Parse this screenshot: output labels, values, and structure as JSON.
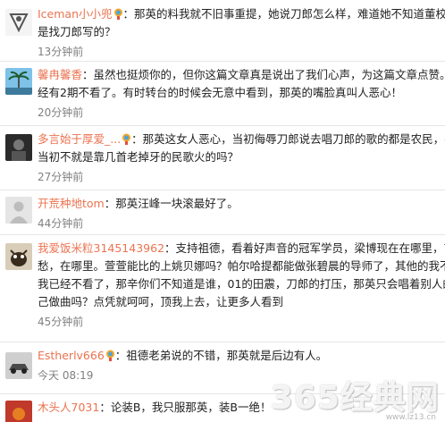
{
  "comments": [
    {
      "user": "Iceman小小兜",
      "lines": [
        "：那英的料我就不旧事重提，她说刀郎怎么样，难道她不知道董校长的一首歌就",
        "是找刀郎写的？"
      ],
      "time": "13分钟前",
      "avatar": "avatar-crest"
    },
    {
      "user": "馨冉馨香",
      "lines": [
        "：虽然也挺烦你的，但你这篇文章真是说出了我们心声，为这篇文章点赞。因为",
        "经有2期不看了。有时转台的时候会无意中看到，那英的嘴脸真叫人恶心！"
      ],
      "time": "20分钟前",
      "avatar": "avatar-palm"
    },
    {
      "user": "多言始于厚爱_...",
      "lines": [
        "：那英这女人恶心，当初侮辱刀郎说去唱刀郎的歌的都是农民，农民",
        "当初不就是靠几首老掉牙的民歌火的吗？"
      ],
      "time": "27分钟前",
      "avatar": "avatar-dark"
    },
    {
      "user": "开荒种地tom",
      "lines": [
        "：那英汪峰一块滚最好了。"
      ],
      "time": "44分钟前",
      "avatar": "avatar-default"
    },
    {
      "user": "我爱饭米粒3145143962",
      "lines": [
        "：支持祖德，看着好声音的冠军学员，梁博现在在哪里，吉克隽逸",
        "愁，在哪里。萱萱能比的上姚贝娜吗？帕尔哈提都能做张碧晨的导师了，其他的我不想再",
        "我已经不看了，那辛你们不知道是谁，01的田震，刀郎的打压，那英只会唱着别人的歌",
        "己做曲吗？点凭就呵呵，顶我上去，让更多人看到"
      ],
      "time": "45分钟前",
      "avatar": "avatar-squirrel"
    },
    {
      "user": "Estherlv666",
      "lines": [
        "：祖德老弟说的不错，那英就是后边有人。"
      ],
      "time": "今天 08:19",
      "avatar": "avatar-car"
    },
    {
      "user": "木头人7031",
      "lines": [
        "：论装B，我只服那英，装B一绝！"
      ],
      "time": "",
      "avatar": "avatar-red"
    }
  ],
  "watermark": "365经典网",
  "watermark_sub": "www.lz13.cn"
}
